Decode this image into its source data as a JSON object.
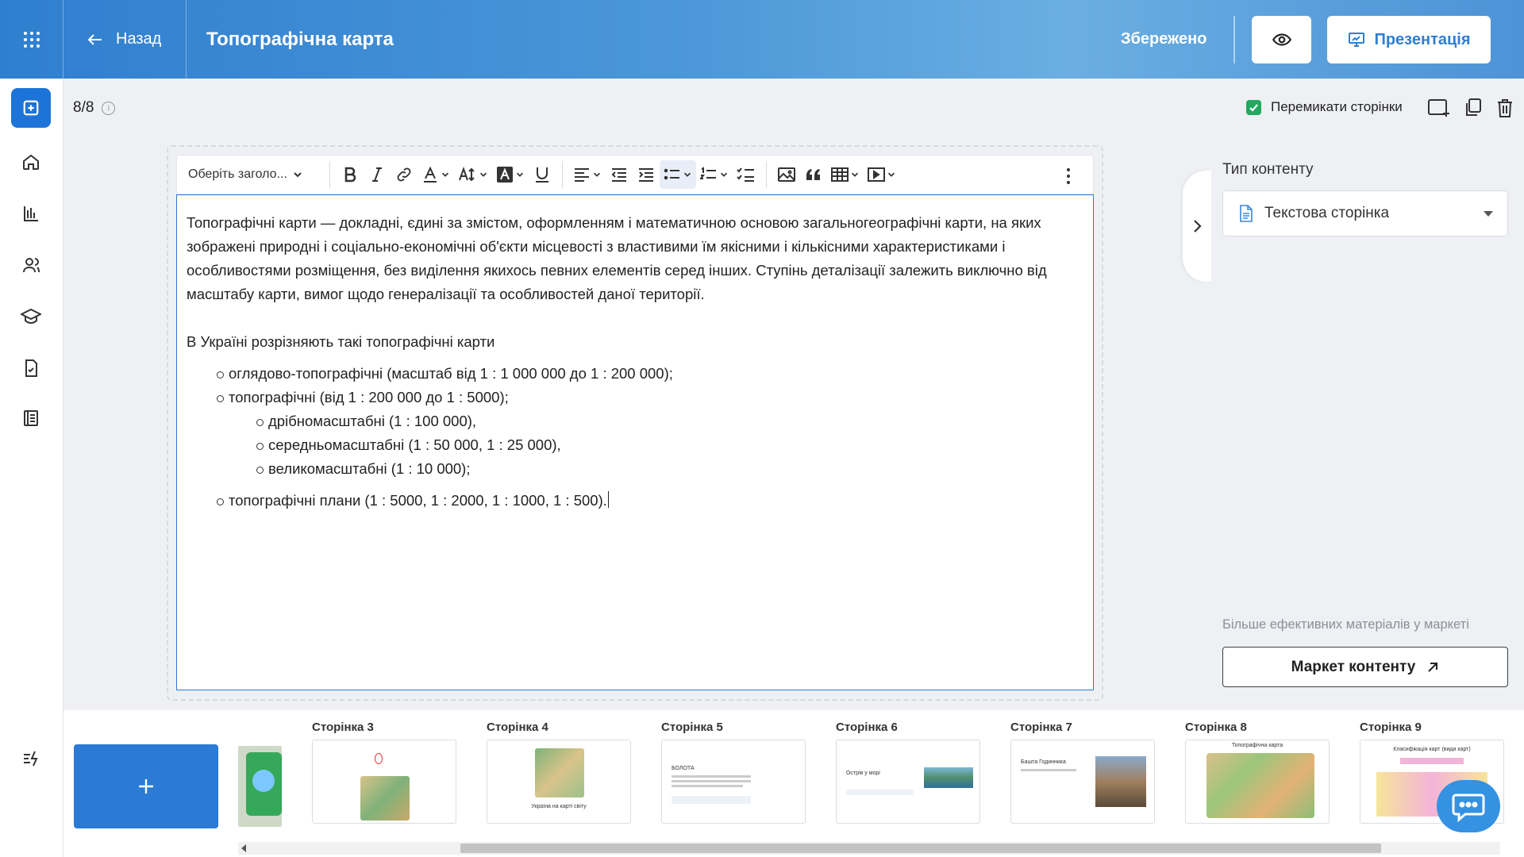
{
  "header": {
    "back_label": "Назад",
    "title": "Топографічна карта",
    "saved_label": "Збережено",
    "present_label": "Презентація"
  },
  "page_counter": "8/8",
  "switch_pages_label": "Перемикати сторінки",
  "toolbar": {
    "heading_select": "Оберіть заголо..."
  },
  "content": {
    "intro": "Топографічні карти — докладні, єдині за змістом, оформленням і математичною основою загальногеографічні карти, на яких зображені природні і соціально-економічні об'єкти місцевості з властивими їм якісними і кількісними характеристиками і особливостями розміщення, без виділення якихось певних елементів серед інших. Ступінь деталізації залежить виключно від масштабу карти, вимог щодо генералізації та особливостей даної території.",
    "subheading": "В Україні розрізняють такі топографічні карти",
    "list_top": [
      "оглядово-топографічні (масштаб від 1 : 1 000 000 до 1 : 200 000);",
      "топографічні (від 1 : 200 000 до 1 : 5000);"
    ],
    "list_nested": [
      "дрібномасштабні (1 : 100 000),",
      "середньомасштабні (1 : 50 000, 1 : 25 000),",
      "великомасштабні (1 : 10 000);"
    ],
    "list_last": "топографічні плани (1 : 5000, 1 : 2000, 1 : 1000, 1 : 500)."
  },
  "right_panel": {
    "content_type_label": "Тип контенту",
    "content_type_value": "Текстова сторінка",
    "market_hint": "Більше ефективних матеріалів у маркеті",
    "market_button": "Маркет контенту"
  },
  "thumbnails": [
    {
      "label": "Сторінка 3",
      "caption": ""
    },
    {
      "label": "Сторінка 4",
      "caption": "Україна на карті світу"
    },
    {
      "label": "Сторінка 5",
      "caption": "БОЛОТА"
    },
    {
      "label": "Сторінка 6",
      "caption": "Острів у морі"
    },
    {
      "label": "Сторінка 7",
      "caption": "Башта Годинника"
    },
    {
      "label": "Сторінка 8",
      "caption": "Топографічна карта"
    },
    {
      "label": "Сторінка 9",
      "caption": "Класифікація карт (види карт)"
    }
  ],
  "colors": {
    "accent": "#2a7ad6",
    "checkbox": "#22a861",
    "header_gradient_start": "#2f7fd0",
    "header_gradient_end": "#6aaee2"
  }
}
